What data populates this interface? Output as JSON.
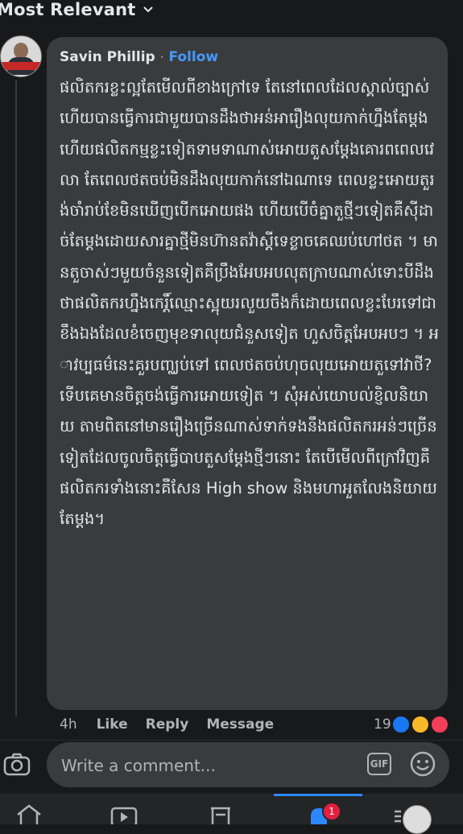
{
  "sort": {
    "label": "Most Relevant"
  },
  "comment": {
    "author": "Savin Phillip",
    "separator": "·",
    "follow_label": "Follow",
    "text": "ផលិតករខ្លះល្អតែមើលពីខាងក្រៅទេ តែនៅពេលដែលស្គាល់ច្បាស់ហើយបានធ្វើការជាមួយបានដឹងថាអន់អារឿងលុយកាក់ហ្នឹងតែម្តង ហើយផលិតកម្មខ្លះទៀតទាមទាណាស់អោយតួសម្តែងគោរពពេលវេលា តែពេលថតចប់មិនដឹងលុយកាក់នៅឯណាទេ ពេលខ្លះអោយតួរង់ចាំរាប់ខែមិនឃើញបើកអោយផង ហើយបើចំគ្នាតួថ្មីៗទៀតគឺស៊ីដាច់តែម្តងដោយសារគ្នាថ្មីមិនហ៊ានតវ៉ាស្តីទេខ្លាចគេឈប់ហៅថត ។ មានតួចាស់ៗមួយចំនួនទៀតគឺប្រឹងអែបអបលុតក្រាបណាស់ទោះបីដឹងថាផលិតករហ្នឹងកេរ្តិ៍ឈ្មោះស្អុយរលួយចឹងក៏ដោយពេលខ្លះបែរទៅជាខឹងឯងដែលខំចេញមុខទាលុយជំនួសទៀត ហួសចិត្តអែបអបៗ ។ អាវប្បធម៌នេះគួរបញ្ឈប់ទៅ ពេលថតចប់ហុចលុយអោយតួទៅវាថី? ទើបគេមានចិត្តចង់ធ្វើការអោយទៀត ។ សុំអស់យោបល់ខ្ញិលនិយាយ តាមពិតនៅមានរឿងច្រើនណាស់ទាក់ទងនឹងផលិតករអន់ៗច្រើនទៀតដែលចូលចិត្តធ្វើបាបតួសម្តែងថ្មីៗនោះ តែបើមើលពីក្រៅវិញគឺផលិតករទាំងនោះគឺសែន High show និងមហាអួតលែងនិយាយតែម្តង។",
    "time": "4h",
    "like_label": "Like",
    "reply_label": "Reply",
    "message_label": "Message",
    "reaction_count": "19"
  },
  "composer": {
    "placeholder": "Write a comment...",
    "gif_label": "GIF"
  },
  "tabbar": {
    "notification_count": "1"
  },
  "colors": {
    "background": "#18191a",
    "bubble": "#3a3b3c",
    "accent": "#4599ff",
    "secondary_text": "#b0b3b8"
  }
}
